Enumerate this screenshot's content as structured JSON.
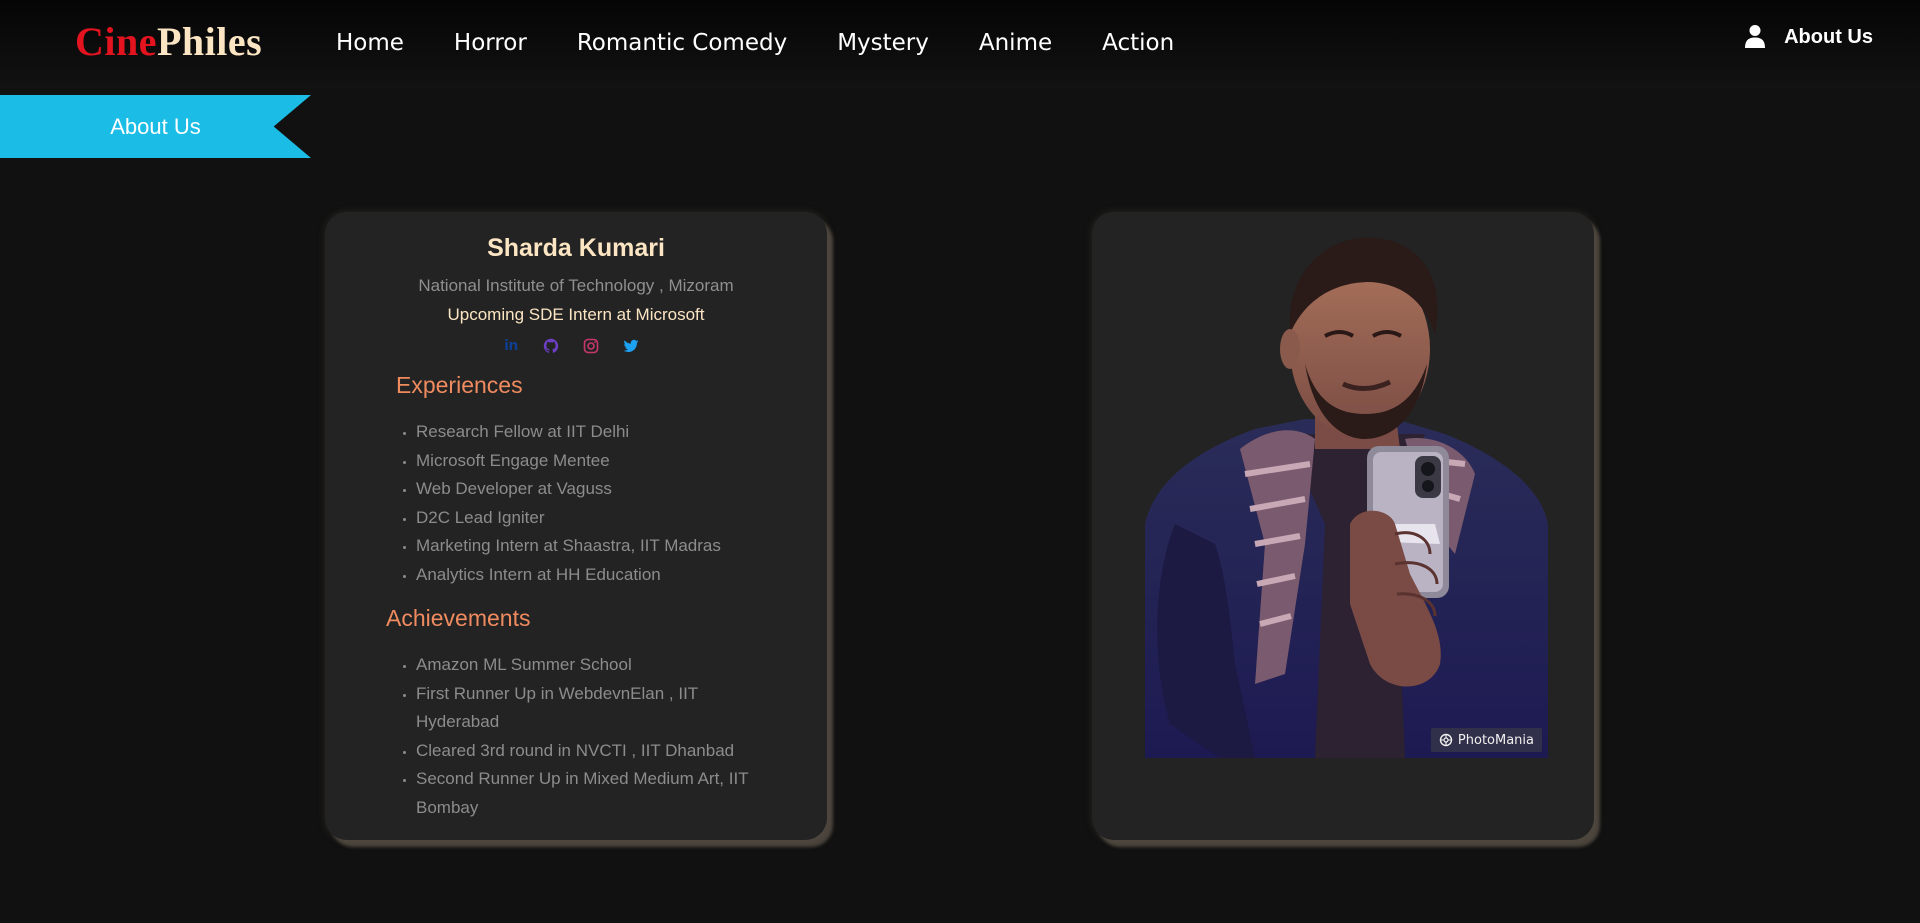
{
  "brand": {
    "part1": "Cine",
    "part2": "Philes",
    "colors": {
      "part1": "#e3131f",
      "part2": "#fbe5c3"
    }
  },
  "nav": {
    "links": [
      "Home",
      "Horror",
      "Romantic Comedy",
      "Mystery",
      "Anime",
      "Action"
    ],
    "account_label": "About Us",
    "account_icon": "user-icon"
  },
  "ribbon": {
    "label": "About Us",
    "color": "#1bbde6"
  },
  "profile": {
    "name": "Sharda Kumari",
    "college": "National Institute of Technology , Mizoram",
    "role": "Upcoming SDE Intern at Microsoft",
    "social_icons": [
      "linkedin-icon",
      "github-icon",
      "instagram-icon",
      "twitter-icon"
    ],
    "experiences_title": "Experiences",
    "experiences": [
      "Research Fellow at IIT Delhi",
      "Microsoft Engage Mentee",
      "Web Developer at Vaguss",
      "D2C Lead Igniter",
      "Marketing Intern at Shaastra, IIT Madras",
      "Analytics Intern at HH Education"
    ],
    "achievements_title": "Achievements",
    "achievements": [
      "Amazon ML Summer School",
      "First Runner Up in WebdevnElan , IIT Hyderabad",
      "Cleared 3rd round in NVCTI , IIT Dhanbad",
      "Second Runner Up in Mixed Medium Art, IIT Bombay"
    ]
  },
  "photo": {
    "watermark": "PhotoMania"
  },
  "colors": {
    "background": "#111111",
    "card": "#232323",
    "heading_accent": "#ef8b5f",
    "muted_text": "#8c8c8c"
  }
}
